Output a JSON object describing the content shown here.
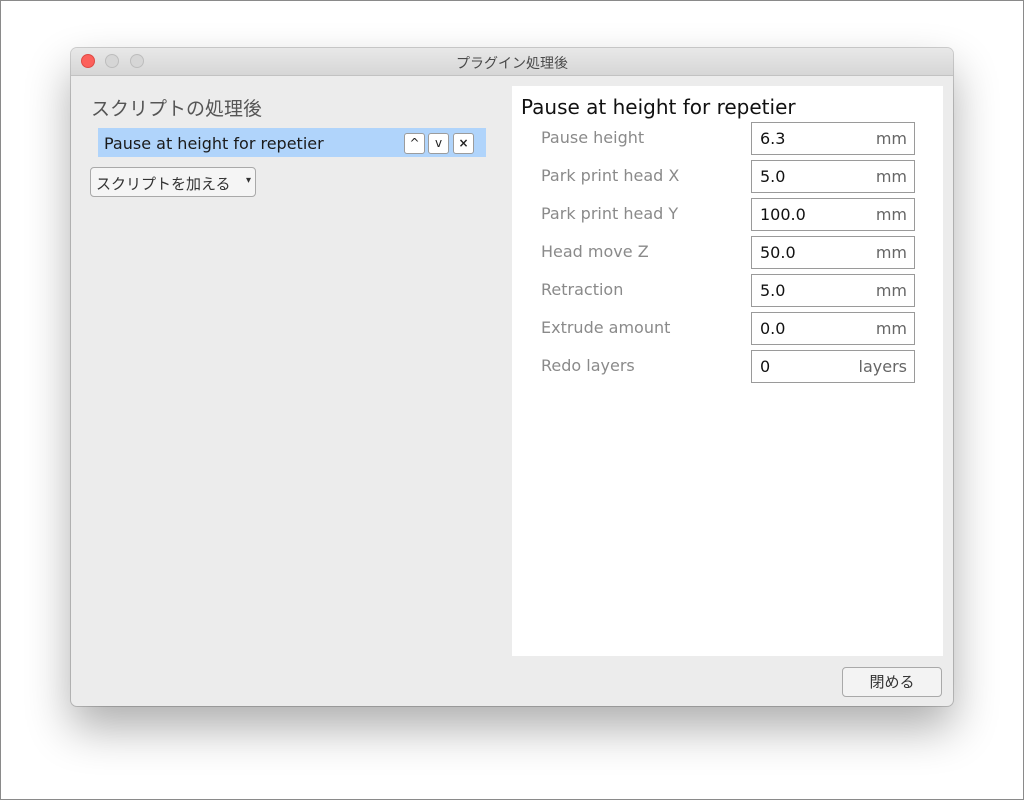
{
  "window": {
    "title": "プラグイン処理後"
  },
  "left_panel": {
    "heading": "スクリプトの処理後",
    "scripts": [
      {
        "label": "Pause at height for repetier",
        "selected": true
      }
    ],
    "row_buttons": {
      "up": "^",
      "down": "v",
      "remove": "×"
    },
    "add_script_label": "スクリプトを加える",
    "add_script_caret": "▾"
  },
  "settings": {
    "title": "Pause at height for repetier",
    "fields": [
      {
        "label": "Pause height",
        "value": "6.3",
        "unit": "mm"
      },
      {
        "label": "Park print head X",
        "value": "5.0",
        "unit": "mm"
      },
      {
        "label": "Park print head Y",
        "value": "100.0",
        "unit": "mm"
      },
      {
        "label": "Head move Z",
        "value": "50.0",
        "unit": "mm"
      },
      {
        "label": "Retraction",
        "value": "5.0",
        "unit": "mm"
      },
      {
        "label": "Extrude amount",
        "value": "0.0",
        "unit": "mm"
      },
      {
        "label": "Redo layers",
        "value": "0",
        "unit": "layers"
      }
    ]
  },
  "footer": {
    "close_label": "閉める"
  },
  "colors": {
    "selection": "#b0d4fb",
    "close_traffic_light": "#fc605b",
    "window_background": "#ececec"
  }
}
